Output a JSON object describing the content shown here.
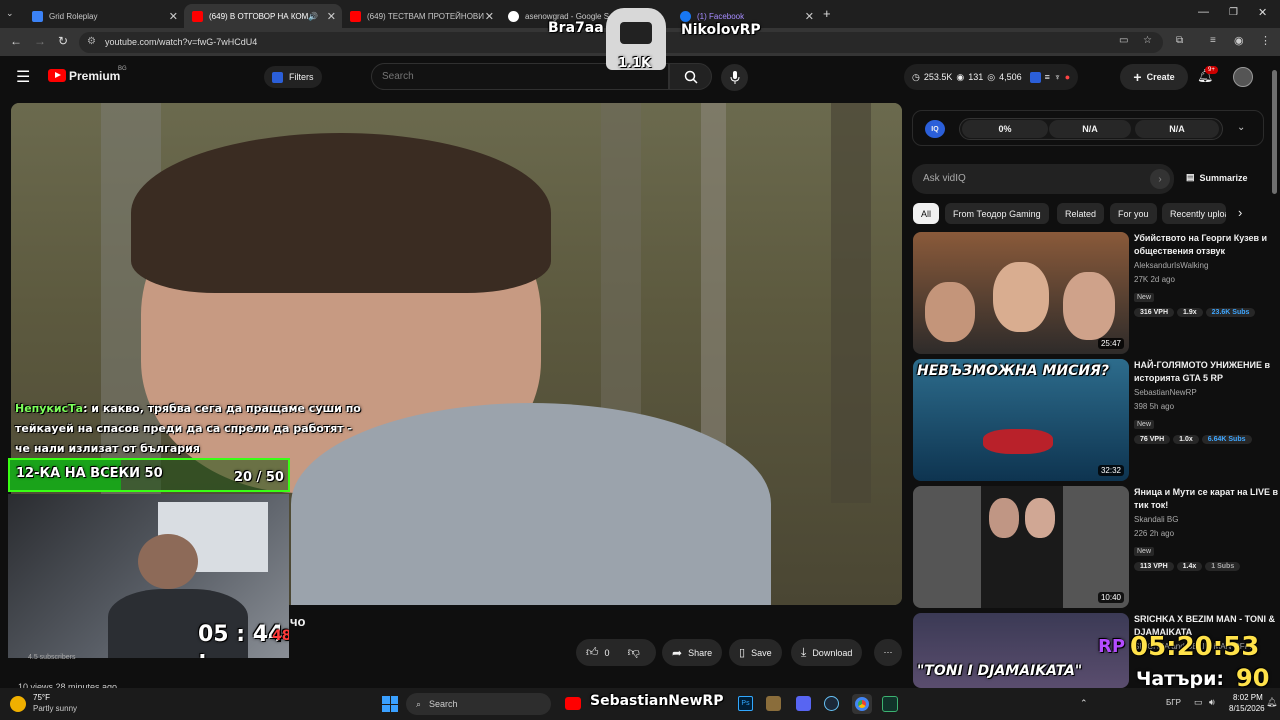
{
  "tabs": [
    {
      "title": "Grid Roleplay",
      "color": "#3b82f6"
    },
    {
      "title": "(649) В ОТГОВОР НА КОМ",
      "color": "#ff0000"
    },
    {
      "title": "(649) ТЕСТВАМ ПРОТЕЙНОВИ",
      "color": "#ff0000"
    },
    {
      "title": "asenowgrad - Google Se",
      "color": "#4285f4"
    },
    {
      "title": "(1) Facebook",
      "color": "#1877f2"
    }
  ],
  "url": "youtube.com/watch?v=fwG-7wHCdU4",
  "yt": {
    "logo": "Premium",
    "region": "BG",
    "filters": "Filters",
    "search_placeholder": "Search",
    "stats": {
      "subs": "253.5K",
      "videos": "131",
      "views": "4,506"
    },
    "create": "Create",
    "notif_count": "9+"
  },
  "vidiq": {
    "score": "0%",
    "na1": "N/A",
    "na2": "N/A",
    "ask_placeholder": "Ask vidIQ",
    "summarize": "Summarize"
  },
  "chips": [
    "All",
    "From Теодор Gaming",
    "Related",
    "For you",
    "Recently uploaded"
  ],
  "recommendations": [
    {
      "title": "Убийството на Георги Кузев и обществения отзвук",
      "channel": "AleksandurIsWalking",
      "meta": "27K  2d ago",
      "new": "New",
      "vph": "316 VPH",
      "ratio": "1.9x",
      "subs": "23.6K Subs",
      "duration": "25:47",
      "subs_color": "#3ea6ff"
    },
    {
      "title": "НАЙ-ГОЛЯМОТО УНИЖЕНИЕ в историята GTA 5 RP",
      "channel": "SebastianNewRP",
      "meta": "398  5h ago",
      "new": "New",
      "vph": "76 VPH",
      "ratio": "1.0x",
      "subs": "6.64K Subs",
      "duration": "32:32",
      "thumb_text": "НЕВЪЗМОЖНА МИСИЯ?",
      "subs_color": "#3ea6ff"
    },
    {
      "title": "Яница и Мути се карат на LIVE в тик ток!",
      "channel": "Skandali BG",
      "meta": "226  2h ago",
      "new": "New",
      "vph": "113 VPH",
      "ratio": "1.4x",
      "subs": "1 Subs",
      "duration": "10:40",
      "subs_color": "#aaaaaa"
    },
    {
      "title": "SRICHKA X BEZIM MAN - TONI & DJAMAIKATA",
      "channel": "SRICHKA and BEZIM MAN OFFIC",
      "meta": "",
      "new": "",
      "vph": "",
      "ratio": "",
      "subs": "",
      "duration": "",
      "thumb_text": "\"TONI I DJAMAIKATA\"",
      "subs_color": "#aaaaaa"
    }
  ],
  "actions": {
    "likes": "0",
    "share": "Share",
    "save": "Save",
    "download": "Download"
  },
  "below": {
    "views": "10 views  28 minutes ago",
    "subscribers": "4.5 subscribers",
    "caption": "чо"
  },
  "overlay": {
    "top_left_name": "Bra7aa",
    "top_right_name": "NikolovRP",
    "center_count": "1.1K",
    "chat_user": "НепукисТа",
    "chat_text": ": и какво, трябва сега да пращаме суши по тейкауей на спасов преди да са спрели да работят - че нали излизат от българия",
    "goal_label": "12-КА НА ВСЕКИ 50",
    "goal_progress": "20 / 50",
    "goal_fraction": 0.4,
    "timer_hm": "05 : 44 :",
    "timer_s": "48",
    "bottom_name": "SebastianNewRP",
    "rp_clock": "05:20:53",
    "rp_prefix": "RP",
    "rp_day": "Чатъри:",
    "rp_day_num": "90"
  },
  "taskbar": {
    "temp": "75°F",
    "weather": "Partly sunny",
    "search": "Search",
    "lang": "БГР",
    "time": "8:02 PM",
    "date": "8/15/2026"
  }
}
